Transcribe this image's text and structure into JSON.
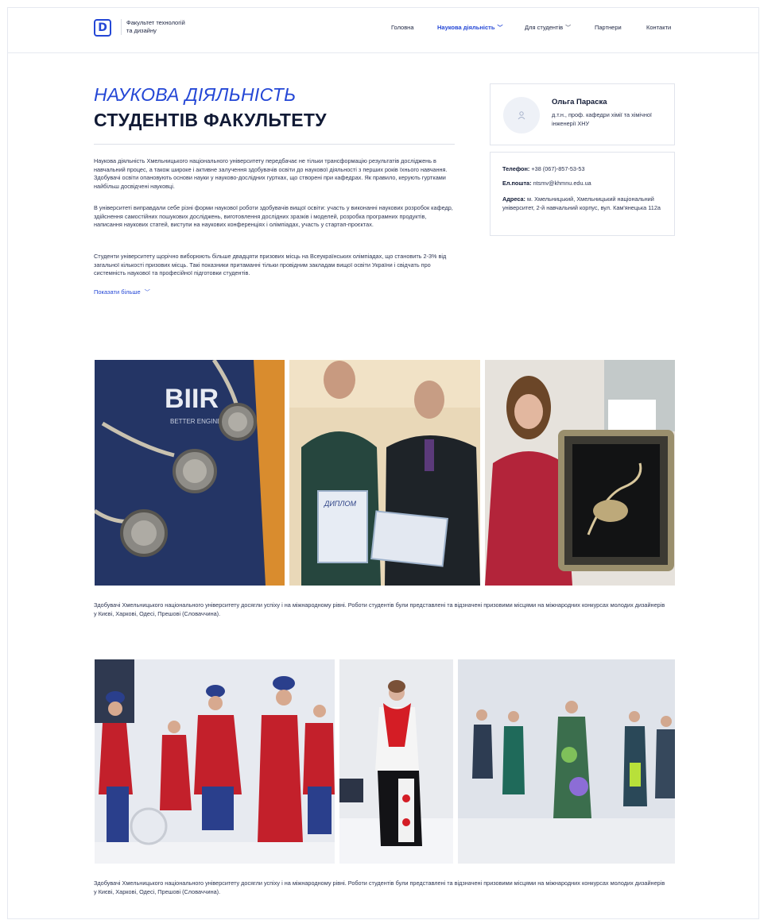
{
  "header": {
    "logo_letter": "D",
    "brand_line1": "Факультет технологій",
    "brand_line2": "та дизайну",
    "nav": [
      {
        "label": "Головна",
        "chevron": false
      },
      {
        "label": "Наукова діяльність",
        "chevron": true,
        "active": true
      },
      {
        "label": "Для студентів",
        "chevron": true
      },
      {
        "label": "Партнери",
        "chevron": false
      },
      {
        "label": "Контакти",
        "chevron": false
      }
    ],
    "chevron_icon": "chevron-down-icon"
  },
  "hero": {
    "title_line1": "НАУКОВА ДІЯЛЬНІСТЬ",
    "title_line2": "СТУДЕНТІВ ФАКУЛЬТЕТУ",
    "paragraphs": [
      "Наукова діяльність Хмельницького національного університету передбачає не тільки трансформацію результатів досліджень в навчальний процес, а також широке і активне залучення здобувачів освіти до наукової діяльності з перших років їхнього навчання. Здобувачі освіти опановують основи науки у науково-дослідних гуртках, що створені при кафедрах. Як правило, керують гуртками найбільш досвідчені науковці.",
      "В університеті виправдали себе різні форми наукової роботи здобувачів вищої освіти: участь у виконанні наукових розробок кафедр, здійснення самостійних пошукових досліджень, виготовлення дослідних зразків і моделей, розробка програмних продуктів, написання наукових статей, виступи на наукових конференціях і олімпіадах, участь у стартап-проєктах.",
      "Студенти університету щорічно виборюють більше двадцяти призових місць на Всеукраїнських олімпіадах, що становить 2-3% від загальної кількості призових місць. Такі показники притаманні тільки провідним закладам вищої освіти України і свідчать про системність наукової та професійної підготовки студентів."
    ],
    "show_more": "Показати більше"
  },
  "contact": {
    "name": "Ольга Параска",
    "role": "д.т.н., проф. кафедри хімії та хімічної інженерії ХНУ",
    "phone_label": "Телефон:",
    "phone": "+38 (067)-857-53-53",
    "email_label": "Ел.пошта:",
    "email": "ntsmv@khmnu.edu.ua",
    "address_label": "Адреса:",
    "address": "м. Хмельницький, Хмельницький національний університет, 2-й навчальний корпус, вул. Кам'янецька 112а",
    "avatar_icon": "user-icon"
  },
  "gallery1": {
    "photo1_text": "BIIR",
    "photo1_subtext": "BETTER ENGINEERING",
    "diploma_text": "ДИПЛОМ",
    "caption": "Здобувачі Хмельницького національного університету досягли успіху і на міжнародному рівні. Роботи студентів були представлені та відзначені призовими місцями на міжнародних конкурсах молодих дизайнерів у Києві, Харкові, Одесі, Прешові (Словаччина)."
  },
  "gallery2": {
    "caption": "Здобувачі Хмельницького національного університету досягли успіху і на міжнародному рівні. Роботи студентів були представлені та відзначені призовими місцями на міжнародних конкурсах молодих дизайнерів у Києві, Харкові, Одесі, Прешові (Словаччина)."
  },
  "colors": {
    "accent": "#2447d6",
    "text": "#1b2340",
    "border": "#e1e4ec"
  }
}
